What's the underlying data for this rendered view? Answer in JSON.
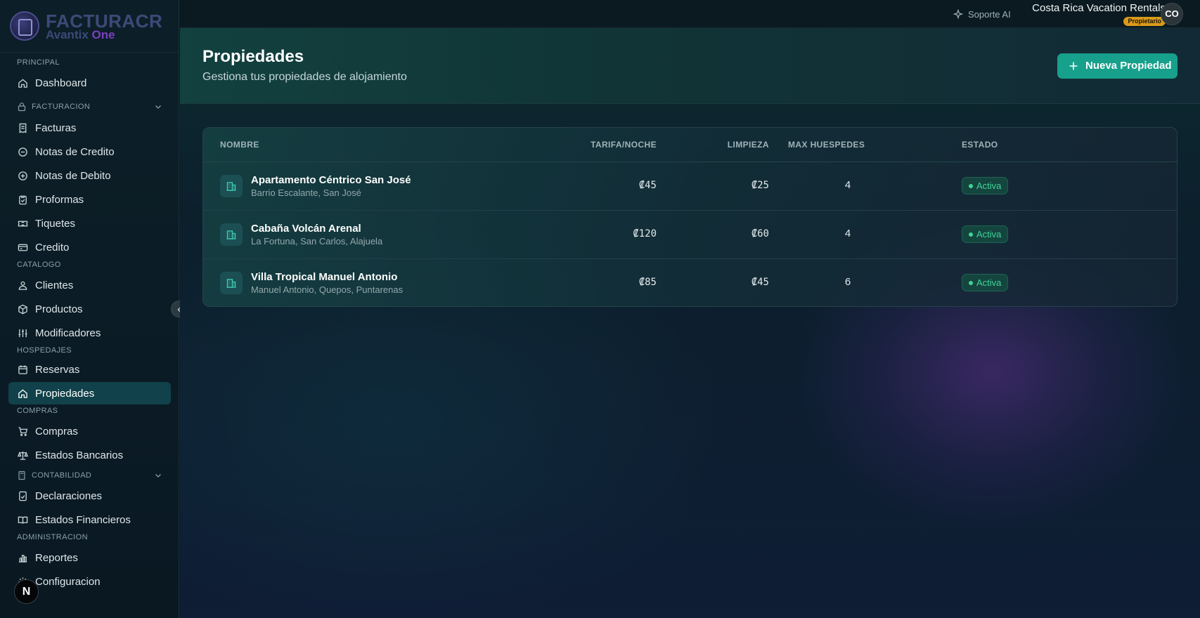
{
  "brand": {
    "title": "FACTURACR",
    "sub_prefix": "Avantix",
    "sub_accent": "One"
  },
  "sidebar": {
    "principal_label": "PRINCIPAL",
    "dashboard": "Dashboard",
    "facturacion_label": "FACTURACION",
    "facturas": "Facturas",
    "notas_credito": "Notas de Credito",
    "notas_debito": "Notas de Debito",
    "proformas": "Proformas",
    "tiquetes": "Tiquetes",
    "credito": "Credito",
    "catalogo_label": "CATALOGO",
    "clientes": "Clientes",
    "productos": "Productos",
    "modificadores": "Modificadores",
    "hospedajes_label": "HOSPEDAJES",
    "reservas": "Reservas",
    "propiedades": "Propiedades",
    "compras_label": "COMPRAS",
    "compras": "Compras",
    "estados_bancarios": "Estados Bancarios",
    "contabilidad_label": "CONTABILIDAD",
    "declaraciones": "Declaraciones",
    "estados_financieros": "Estados Financieros",
    "administracion_label": "ADMINISTRACION",
    "reportes": "Reportes",
    "configuracion": "Configuracion",
    "n_badge": "N"
  },
  "topbar": {
    "support": "Soporte AI",
    "company": "Costa Rica Vacation Rentals",
    "role": "Propietario",
    "avatar": "CO"
  },
  "page": {
    "title": "Propiedades",
    "subtitle": "Gestiona tus propiedades de alojamiento",
    "new_button": "Nueva Propiedad"
  },
  "table": {
    "headers": {
      "nombre": "NOMBRE",
      "tarifa": "TARIFA/NOCHE",
      "limpieza": "LIMPIEZA",
      "max": "MAX HUESPEDES",
      "estado": "ESTADO"
    },
    "rows": [
      {
        "name": "Apartamento Céntrico San José",
        "location": "Barrio Escalante, San José",
        "rate": "₡45",
        "cleaning": "₡25",
        "guests": "4",
        "status": "Activa"
      },
      {
        "name": "Cabaña Volcán Arenal",
        "location": "La Fortuna, San Carlos, Alajuela",
        "rate": "₡120",
        "cleaning": "₡60",
        "guests": "4",
        "status": "Activa"
      },
      {
        "name": "Villa Tropical Manuel Antonio",
        "location": "Manuel Antonio, Quepos, Puntarenas",
        "rate": "₡85",
        "cleaning": "₡45",
        "guests": "6",
        "status": "Activa"
      }
    ]
  },
  "colors": {
    "accent": "#17a08c",
    "active_nav": "#11414a",
    "status_green": "#3fd49a",
    "role_badge": "#d99a1b",
    "brand_accent": "#7b3fbf"
  }
}
